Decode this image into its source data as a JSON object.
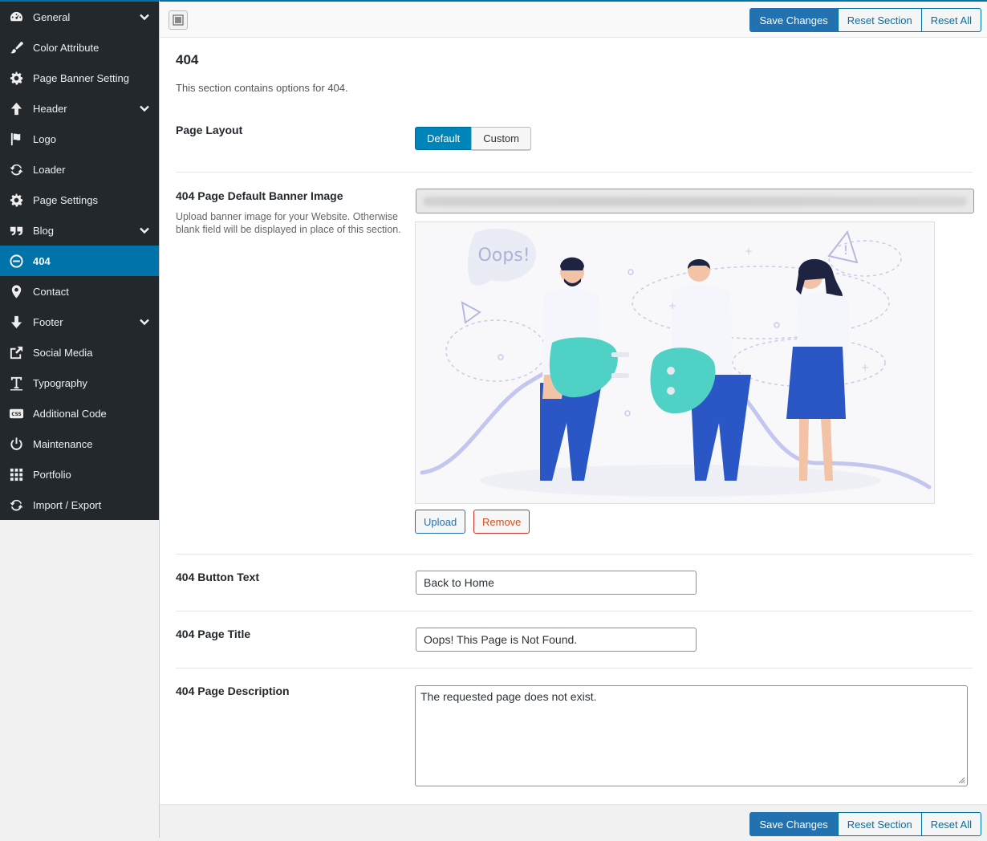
{
  "sidebar": {
    "items": [
      {
        "label": "General",
        "icon": "dashboard-gauge-icon",
        "expandable": true
      },
      {
        "label": "Color Attribute",
        "icon": "paintbrush-icon",
        "expandable": false
      },
      {
        "label": "Page Banner Setting",
        "icon": "gear-icon",
        "expandable": false
      },
      {
        "label": "Header",
        "icon": "arrow-up-icon",
        "expandable": true
      },
      {
        "label": "Logo",
        "icon": "flag-icon",
        "expandable": false
      },
      {
        "label": "Loader",
        "icon": "refresh-icon",
        "expandable": false
      },
      {
        "label": "Page Settings",
        "icon": "gear-icon",
        "expandable": false
      },
      {
        "label": "Blog",
        "icon": "quote-icon",
        "expandable": true
      },
      {
        "label": "404",
        "icon": "minus-circle-icon",
        "expandable": false,
        "active": true
      },
      {
        "label": "Contact",
        "icon": "location-pin-icon",
        "expandable": false
      },
      {
        "label": "Footer",
        "icon": "arrow-down-icon",
        "expandable": true
      },
      {
        "label": "Social Media",
        "icon": "share-icon",
        "expandable": false
      },
      {
        "label": "Typography",
        "icon": "text-t-icon",
        "expandable": false
      },
      {
        "label": "Additional Code",
        "icon": "css-icon",
        "expandable": false
      },
      {
        "label": "Maintenance",
        "icon": "power-icon",
        "expandable": false
      },
      {
        "label": "Portfolio",
        "icon": "grid-icon",
        "expandable": false
      },
      {
        "label": "Import / Export",
        "icon": "refresh-icon",
        "expandable": false
      }
    ]
  },
  "toolbar": {
    "save_label": "Save Changes",
    "reset_section_label": "Reset Section",
    "reset_all_label": "Reset All"
  },
  "section": {
    "title": "404",
    "description": "This section contains options for 404."
  },
  "fields": {
    "page_layout": {
      "label": "Page Layout",
      "options": [
        "Default",
        "Custom"
      ],
      "selected": "Default"
    },
    "banner_image": {
      "label": "404 Page Default Banner Image",
      "description": "Upload banner image for your Website. Otherwise blank field will be displayed in place of this section.",
      "preview_text": "Oops!",
      "upload_label": "Upload",
      "remove_label": "Remove"
    },
    "button_text": {
      "label": "404 Button Text",
      "value": "Back to Home"
    },
    "page_title": {
      "label": "404 Page Title",
      "value": "Oops! This Page is Not Found."
    },
    "page_description": {
      "label": "404 Page Description",
      "value": "The requested page does not exist."
    }
  },
  "colors": {
    "sidebar_bg": "#23282d",
    "accent": "#0073aa",
    "primary_button": "#2271b1",
    "remove_red": "#d54e21"
  }
}
